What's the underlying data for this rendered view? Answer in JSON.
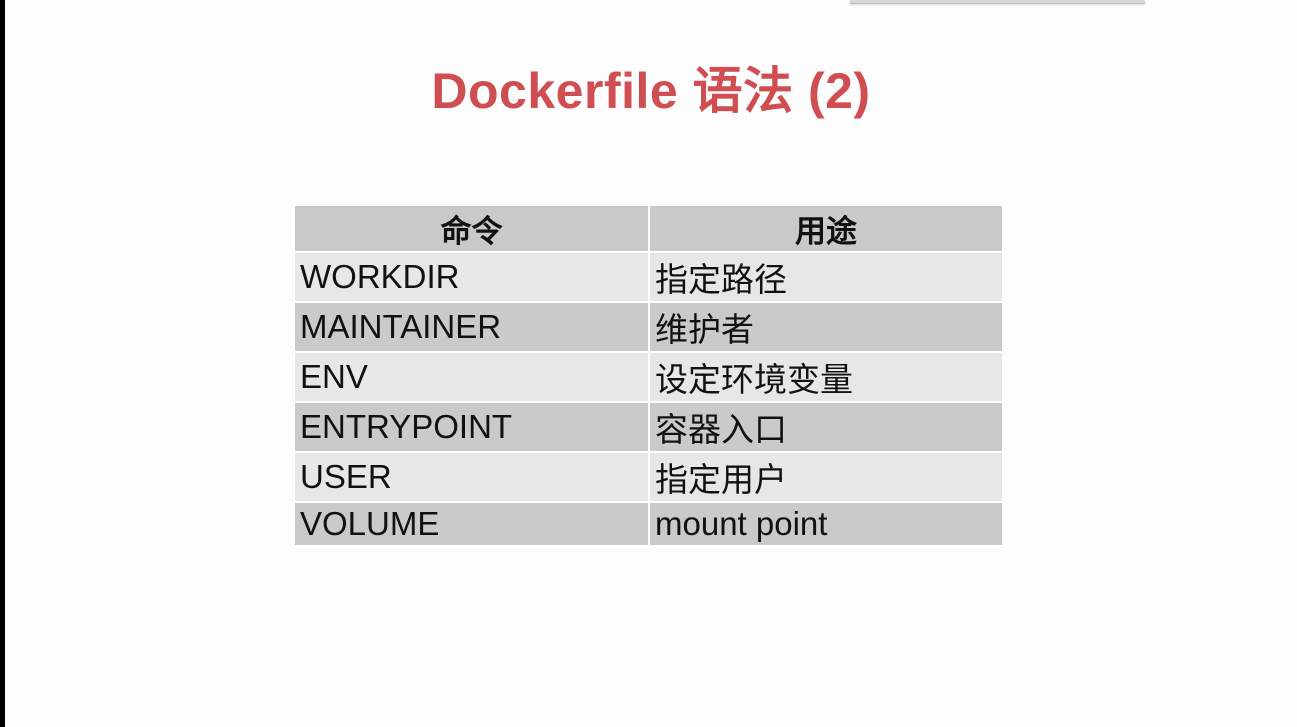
{
  "slide": {
    "title": "Dockerfile 语法 (2)"
  },
  "table": {
    "headers": [
      "命令",
      "用途"
    ],
    "rows": [
      {
        "command": "WORKDIR",
        "purpose": "指定路径"
      },
      {
        "command": "MAINTAINER",
        "purpose": "维护者"
      },
      {
        "command": "ENV",
        "purpose": "设定环境变量"
      },
      {
        "command": "ENTRYPOINT",
        "purpose": "容器入口"
      },
      {
        "command": "USER",
        "purpose": "指定用户"
      },
      {
        "command": "VOLUME",
        "purpose": "mount point"
      }
    ]
  },
  "colors": {
    "title": "#cf4e51",
    "header_bg": "#c9c9c9",
    "row_light": "#e7e7e7",
    "row_dark": "#cacaca"
  }
}
